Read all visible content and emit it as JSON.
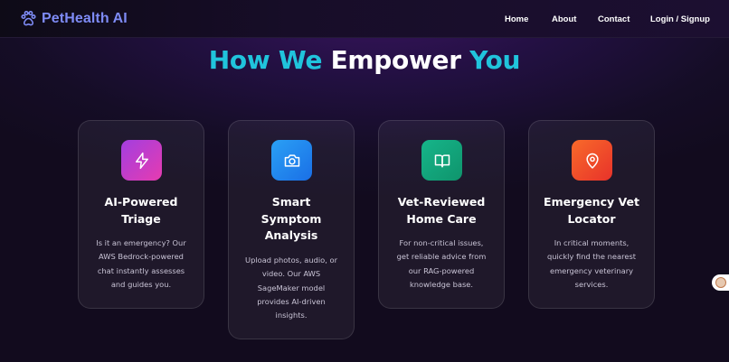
{
  "nav": {
    "brand": "PetHealth AI",
    "links": [
      {
        "label": "Home"
      },
      {
        "label": "About"
      },
      {
        "label": "Contact"
      },
      {
        "label": "Login / Signup"
      }
    ]
  },
  "hero": {
    "title_part1": "How We",
    "title_part2": "Empower",
    "title_part3": "You"
  },
  "features": [
    {
      "icon": "lightning-icon",
      "title": "AI-Powered Triage",
      "description": "Is it an emergency? Our AWS Bedrock-powered chat instantly assesses and guides you.",
      "color": "#c03ed6"
    },
    {
      "icon": "camera-icon",
      "title": "Smart Symptom Analysis",
      "description": "Upload photos, audio, or video. Our AWS SageMaker model provides AI-driven insights.",
      "color": "#1f8cf0"
    },
    {
      "icon": "book-icon",
      "title": "Vet-Reviewed Home Care",
      "description": "For non-critical issues, get reliable advice from our RAG-powered knowledge base.",
      "color": "#12a47a"
    },
    {
      "icon": "map-pin-icon",
      "title": "Emergency Vet Locator",
      "description": "In critical moments, quickly find the nearest emergency veterinary services.",
      "color": "#f0482a"
    }
  ],
  "colors": {
    "brand": "#7e8bf5",
    "accent_cyan": "#20c4dc",
    "background": "#150d26"
  }
}
